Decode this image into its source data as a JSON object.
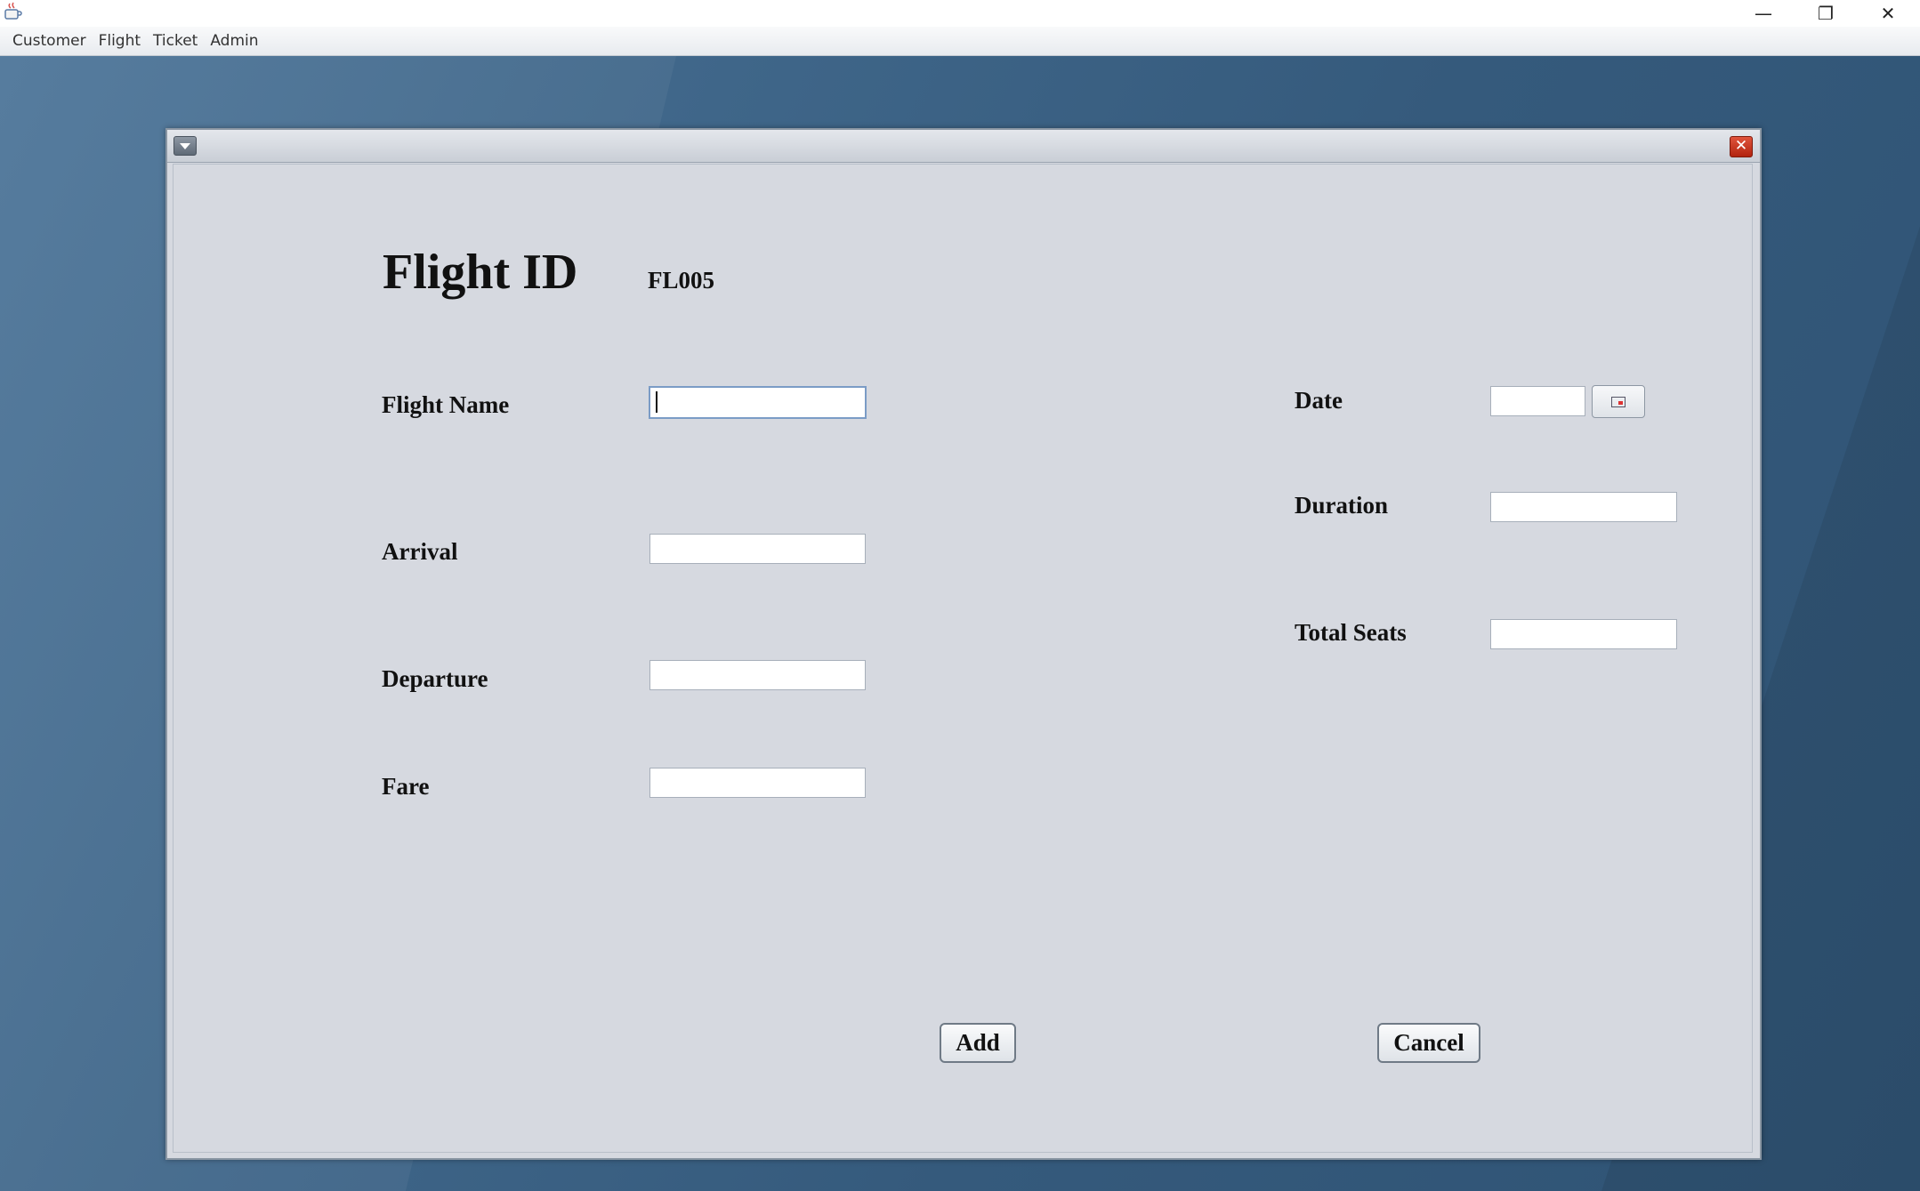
{
  "menubar": {
    "items": [
      "Customer",
      "Flight",
      "Ticket",
      "Admin"
    ]
  },
  "window_controls": {
    "minimize": "—",
    "maximize": "❐",
    "close": "✕"
  },
  "internal_frame": {
    "close_symbol": "✕"
  },
  "form": {
    "flight_id_label": "Flight ID",
    "flight_id_value": "FL005",
    "flight_name_label": "Flight Name",
    "flight_name_value": "",
    "arrival_label": "Arrival",
    "arrival_value": "",
    "departure_label": "Departure",
    "departure_value": "",
    "fare_label": "Fare",
    "fare_value": "",
    "date_label": "Date",
    "date_value": "",
    "duration_label": "Duration",
    "duration_value": "",
    "total_seats_label": "Total Seats",
    "total_seats_value": ""
  },
  "buttons": {
    "add": "Add",
    "cancel": "Cancel"
  }
}
